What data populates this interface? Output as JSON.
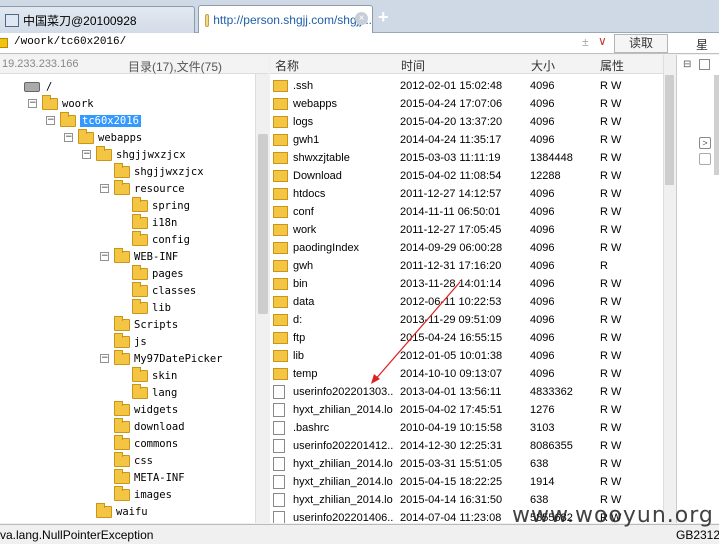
{
  "tabs": [
    {
      "label": "中国菜刀@20100928"
    },
    {
      "label": "http://person.shgjj.com/shgjj..."
    }
  ],
  "address": {
    "path": "/woork/tc60x2016/",
    "read_button": "读取",
    "bookmark": "星期"
  },
  "left_header": {
    "ip": "19.233.233.166",
    "count": "目录(17),文件(75)"
  },
  "tree": [
    {
      "label": "/",
      "level": 0,
      "toggle": "",
      "icon": "drive"
    },
    {
      "label": "woork",
      "level": 1,
      "toggle": "−"
    },
    {
      "label": "tc60x2016",
      "level": 2,
      "toggle": "−",
      "selected": true
    },
    {
      "label": "webapps",
      "level": 3,
      "toggle": "−"
    },
    {
      "label": "shgjjwxzjcx",
      "level": 4,
      "toggle": "−"
    },
    {
      "label": "shgjjwxzjcx",
      "level": 5,
      "toggle": ""
    },
    {
      "label": "resource",
      "level": 5,
      "toggle": "−"
    },
    {
      "label": "spring",
      "level": 6,
      "toggle": ""
    },
    {
      "label": "i18n",
      "level": 6,
      "toggle": ""
    },
    {
      "label": "config",
      "level": 6,
      "toggle": ""
    },
    {
      "label": "WEB-INF",
      "level": 5,
      "toggle": "−"
    },
    {
      "label": "pages",
      "level": 6,
      "toggle": ""
    },
    {
      "label": "classes",
      "level": 6,
      "toggle": ""
    },
    {
      "label": "lib",
      "level": 6,
      "toggle": ""
    },
    {
      "label": "Scripts",
      "level": 5,
      "toggle": ""
    },
    {
      "label": "js",
      "level": 5,
      "toggle": ""
    },
    {
      "label": "My97DatePicker",
      "level": 5,
      "toggle": "−"
    },
    {
      "label": "skin",
      "level": 6,
      "toggle": ""
    },
    {
      "label": "lang",
      "level": 6,
      "toggle": ""
    },
    {
      "label": "widgets",
      "level": 5,
      "toggle": ""
    },
    {
      "label": "download",
      "level": 5,
      "toggle": ""
    },
    {
      "label": "commons",
      "level": 5,
      "toggle": ""
    },
    {
      "label": "css",
      "level": 5,
      "toggle": ""
    },
    {
      "label": "META-INF",
      "level": 5,
      "toggle": ""
    },
    {
      "label": "images",
      "level": 5,
      "toggle": ""
    },
    {
      "label": "waifu",
      "level": 4,
      "toggle": ""
    }
  ],
  "columns": {
    "name": "名称",
    "time": "时间",
    "size": "大小",
    "perm": "属性"
  },
  "files": [
    {
      "name": ".ssh",
      "time": "2012-02-01 15:02:48",
      "size": "4096",
      "perm": "R W",
      "type": "folder"
    },
    {
      "name": "webapps",
      "time": "2015-04-24 17:07:06",
      "size": "4096",
      "perm": "R W",
      "type": "folder"
    },
    {
      "name": "logs",
      "time": "2015-04-20 13:37:20",
      "size": "4096",
      "perm": "R W",
      "type": "folder"
    },
    {
      "name": "gwh1",
      "time": "2014-04-24 11:35:17",
      "size": "4096",
      "perm": "R W",
      "type": "folder"
    },
    {
      "name": "shwxzjtable",
      "time": "2015-03-03 11:11:19",
      "size": "1384448",
      "perm": "R W",
      "type": "folder"
    },
    {
      "name": "Download",
      "time": "2015-04-02 11:08:54",
      "size": "12288",
      "perm": "R W",
      "type": "folder"
    },
    {
      "name": "htdocs",
      "time": "2011-12-27 14:12:57",
      "size": "4096",
      "perm": "R W",
      "type": "folder"
    },
    {
      "name": "conf",
      "time": "2014-11-11 06:50:01",
      "size": "4096",
      "perm": "R W",
      "type": "folder"
    },
    {
      "name": "work",
      "time": "2011-12-27 17:05:45",
      "size": "4096",
      "perm": "R W",
      "type": "folder"
    },
    {
      "name": "paodingIndex",
      "time": "2014-09-29 06:00:28",
      "size": "4096",
      "perm": "R W",
      "type": "folder"
    },
    {
      "name": "gwh",
      "time": "2011-12-31 17:16:20",
      "size": "4096",
      "perm": "R",
      "type": "folder"
    },
    {
      "name": "bin",
      "time": "2013-11-28 14:01:14",
      "size": "4096",
      "perm": "R W",
      "type": "folder"
    },
    {
      "name": "data",
      "time": "2012-06-11 10:22:53",
      "size": "4096",
      "perm": "R W",
      "type": "folder"
    },
    {
      "name": "d:",
      "time": "2013-11-29 09:51:09",
      "size": "4096",
      "perm": "R W",
      "type": "folder"
    },
    {
      "name": "ftp",
      "time": "2015-04-24 16:55:15",
      "size": "4096",
      "perm": "R W",
      "type": "folder"
    },
    {
      "name": "lib",
      "time": "2012-01-05 10:01:38",
      "size": "4096",
      "perm": "R W",
      "type": "folder"
    },
    {
      "name": "temp",
      "time": "2014-10-10 09:13:07",
      "size": "4096",
      "perm": "R W",
      "type": "folder"
    },
    {
      "name": "userinfo202201303...",
      "time": "2013-04-01 13:56:11",
      "size": "4833362",
      "perm": "R W",
      "type": "file"
    },
    {
      "name": "hyxt_zhilian_2014.lo...",
      "time": "2015-04-02 17:45:51",
      "size": "1276",
      "perm": "R W",
      "type": "file"
    },
    {
      "name": ".bashrc",
      "time": "2010-04-19 10:15:58",
      "size": "3103",
      "perm": "R W",
      "type": "file"
    },
    {
      "name": "userinfo202201412...",
      "time": "2014-12-30 12:25:31",
      "size": "8086355",
      "perm": "R W",
      "type": "file"
    },
    {
      "name": "hyxt_zhilian_2014.lo...",
      "time": "2015-03-31 15:51:05",
      "size": "638",
      "perm": "R W",
      "type": "file"
    },
    {
      "name": "hyxt_zhilian_2014.lo...",
      "time": "2015-04-15 18:22:25",
      "size": "1914",
      "perm": "R W",
      "type": "file"
    },
    {
      "name": "hyxt_zhilian_2014.lo...",
      "time": "2015-04-14 16:31:50",
      "size": "638",
      "perm": "R W",
      "type": "file"
    },
    {
      "name": "userinfo202201406...",
      "time": "2014-07-04 11:23:08",
      "size": "5855682",
      "perm": "R W",
      "type": "file"
    }
  ],
  "status": {
    "message": "va.lang.NullPointerException",
    "encoding": "GB2312"
  },
  "watermark": "www.wooyun.org"
}
